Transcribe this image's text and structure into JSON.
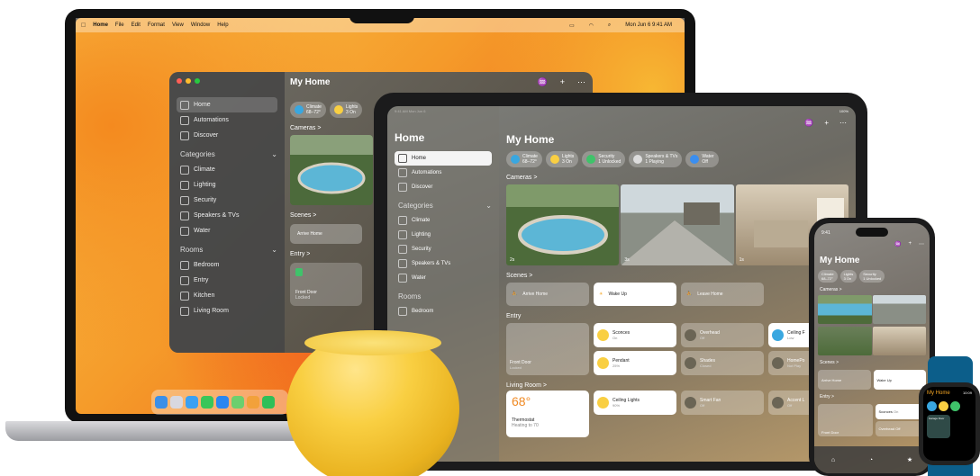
{
  "mac": {
    "menubar": [
      "Home",
      "File",
      "Edit",
      "Format",
      "View",
      "Window",
      "Help"
    ],
    "clock": "Mon Jun 6  9:41 AM",
    "window_title": "My Home",
    "sidebar_top": [
      "Home",
      "Automations",
      "Discover"
    ],
    "categories_label": "Categories",
    "categories": [
      "Climate",
      "Lighting",
      "Security",
      "Speakers & TVs",
      "Water"
    ],
    "rooms_label": "Rooms",
    "rooms": [
      "Bedroom",
      "Entry",
      "Kitchen",
      "Living Room"
    ],
    "pills": [
      {
        "title": "Climate",
        "sub": "68–72°"
      },
      {
        "title": "Lights",
        "sub": "3 On"
      }
    ],
    "cameras_label": "Cameras >",
    "scenes_label": "Scenes >",
    "scene": "Arrive Home",
    "entry_label": "Entry >",
    "front_door": "Front Door",
    "front_door_sub": "Locked"
  },
  "ipad": {
    "status_left": "9:41 AM  Mon Jun 6",
    "status_right": "100%",
    "sidebar_title": "Home",
    "sidebar_top": [
      "Home",
      "Automations",
      "Discover"
    ],
    "categories_label": "Categories",
    "categories": [
      "Climate",
      "Lighting",
      "Security",
      "Speakers & TVs",
      "Water"
    ],
    "rooms_label": "Rooms",
    "rooms": [
      "Bedroom"
    ],
    "title": "My Home",
    "pills": [
      {
        "title": "Climate",
        "sub": "68–72°"
      },
      {
        "title": "Lights",
        "sub": "3 On"
      },
      {
        "title": "Security",
        "sub": "1 Unlocked"
      },
      {
        "title": "Speakers & TVs",
        "sub": "1 Playing"
      },
      {
        "title": "Water",
        "sub": "Off"
      }
    ],
    "cameras_label": "Cameras >",
    "cam_labels": [
      "2s",
      "3s",
      "1s"
    ],
    "scenes_label": "Scenes >",
    "scenes": [
      "Arrive Home",
      "Wake Up",
      "Leave Home"
    ],
    "entry_label": "Entry",
    "tiles": [
      {
        "name": "Sconces",
        "sub": "On"
      },
      {
        "name": "Overhead",
        "sub": "Off"
      },
      {
        "name": "Ceiling F",
        "sub": "Low"
      },
      {
        "name": "Pendant",
        "sub": "25%"
      },
      {
        "name": "Shades",
        "sub": "Closed"
      },
      {
        "name": "HomePo",
        "sub": "Not Play"
      }
    ],
    "front_door": "Front Door",
    "front_door_sub": "Locked",
    "living_label": "Living Room >",
    "thermo_value": "68°",
    "thermo_name": "Thermostat",
    "thermo_sub": "Heating to 70",
    "living_tiles": [
      {
        "name": "Ceiling Lights",
        "sub": "90%"
      },
      {
        "name": "Smart Fan",
        "sub": "Off"
      },
      {
        "name": "Accent L",
        "sub": "Off"
      }
    ]
  },
  "iphone": {
    "time": "9:41",
    "title": "My Home",
    "pills": [
      {
        "title": "Climate",
        "sub": "68–72°"
      },
      {
        "title": "Lights",
        "sub": "3 On"
      },
      {
        "title": "Security",
        "sub": "1 Unlocked"
      }
    ],
    "cameras_label": "Cameras >",
    "scenes_label": "Scenes >",
    "scenes": [
      "Arrive Home",
      "Wake Up"
    ],
    "entry_label": "Entry >",
    "tiles": [
      {
        "name": "Sconces",
        "sub": "On"
      },
      {
        "name": "Overhead",
        "sub": "Off"
      }
    ],
    "front_door": "Front Door",
    "tabs": [
      "Home",
      "Automations",
      "Discover"
    ]
  },
  "watch": {
    "title": "My Home",
    "time": "10:09",
    "tile": "Garage Door"
  },
  "colors": {
    "accent_yellow": "#f9cf42",
    "ipad_thermo": "#f08a24",
    "watch_accent": "#f5a623"
  }
}
